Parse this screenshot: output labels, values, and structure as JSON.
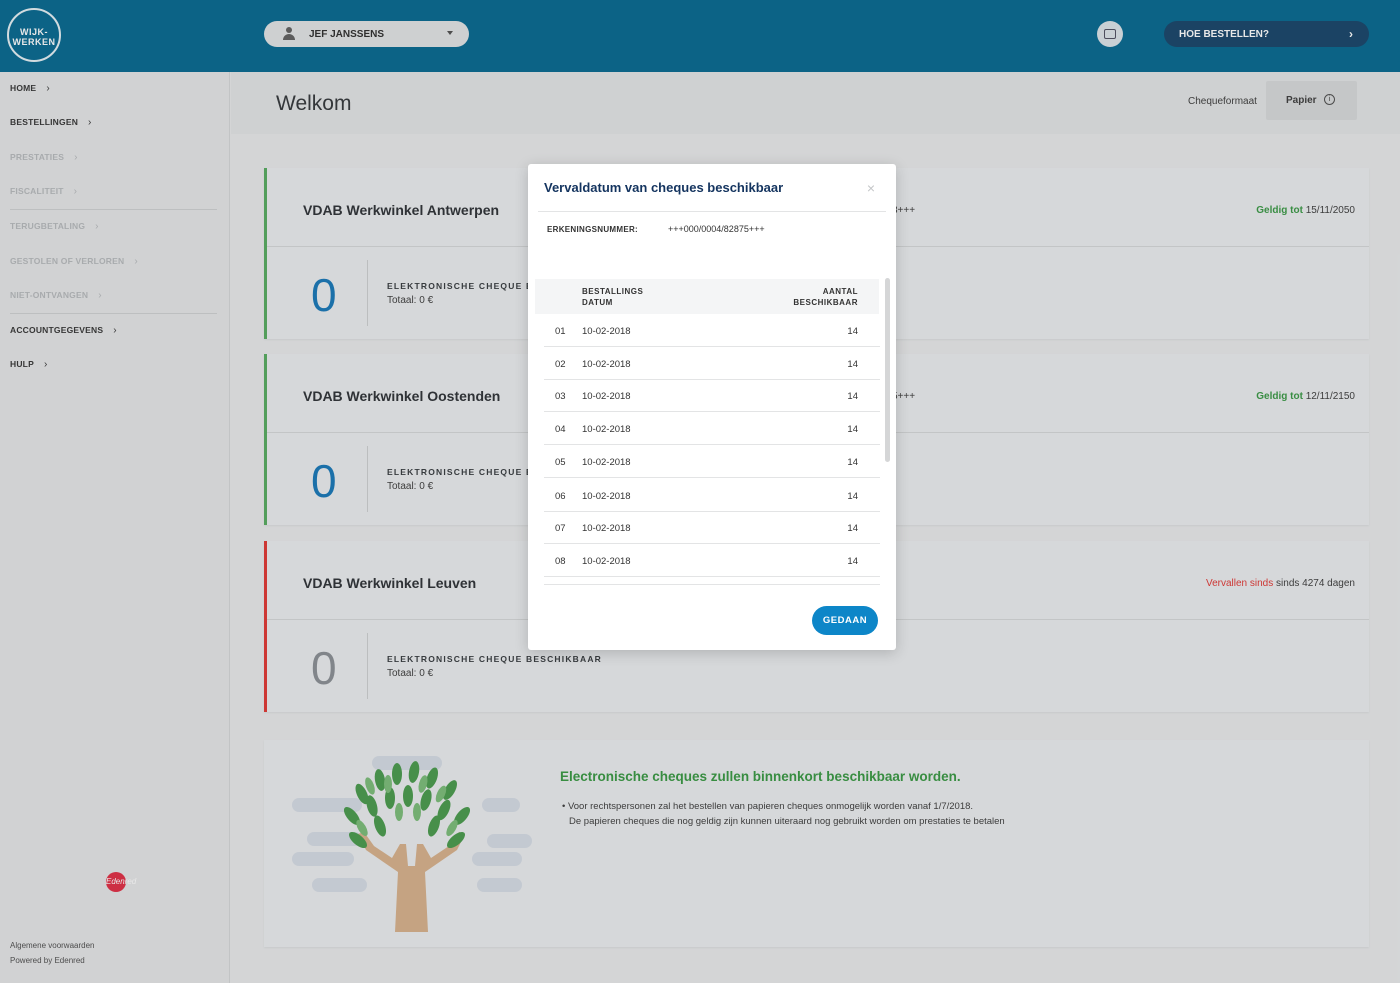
{
  "header": {
    "logo_line1": "WIJK-",
    "logo_line2": "WERKEN",
    "user_name": "JEF JANSSENS",
    "how_to_order": "HOE BESTELLEN?"
  },
  "sidebar": {
    "items": [
      {
        "label": "HOME",
        "enabled": true
      },
      {
        "label": "BESTELLINGEN",
        "enabled": true
      },
      {
        "label": "PRESTATIES",
        "enabled": false
      },
      {
        "label": "FISCALITEIT",
        "enabled": false
      },
      {
        "label": "TERUGBETALING",
        "enabled": false
      },
      {
        "label": "GESTOLEN OF VERLOREN",
        "enabled": false
      },
      {
        "label": "NIET-ONTVANGEN",
        "enabled": false
      },
      {
        "label": "ACCOUNTGEGEVENS",
        "enabled": true
      },
      {
        "label": "HULP",
        "enabled": true
      }
    ],
    "footer_terms": "Algemene voorwaarden",
    "footer_powered": "Powered by Edenred",
    "edenred_logo_text": "Edenred"
  },
  "page": {
    "title": "Welkom",
    "cheque_format_label": "Chequeformaat",
    "cheque_format_value": "Papier"
  },
  "cards": [
    {
      "name": "VDAB Werkwinkel Antwerpen",
      "number_fragment": "3+++",
      "valid_prefix": "Geldig tot",
      "valid_value": "15/11/2050",
      "count": "0",
      "label": "ELEKTRONISCHE CHEQUE B",
      "total": "Totaal: 0 €",
      "status": "green"
    },
    {
      "name": "VDAB Werkwinkel Oostenden",
      "number_fragment": "5+++",
      "valid_prefix": "Geldig tot",
      "valid_value": "12/11/2150",
      "count": "0",
      "label": "ELEKTRONISCHE CHEQUE B",
      "total": "Totaal: 0 €",
      "status": "green"
    },
    {
      "name": "VDAB Werkwinkel Leuven",
      "number_fragment": "",
      "valid_prefix": "Vervallen sinds",
      "valid_value": "sinds 4274 dagen",
      "count": "0",
      "label": "ELEKTRONISCHE CHEQUE BESCHIKBAAR",
      "total": "Totaal: 0 €",
      "status": "red"
    }
  ],
  "info": {
    "title": "Electronische cheques zullen binnenkort beschikbaar worden.",
    "line1": "• Voor rechtspersonen zal het bestellen van papieren cheques onmogelijk worden vanaf 1/7/2018.",
    "line2": "De papieren cheques die nog geldig zijn kunnen uiteraard nog gebruikt worden om prestaties te betalen"
  },
  "modal": {
    "title": "Vervaldatum van cheques beschikbaar",
    "close": "×",
    "erkenning_label": "ERKENINGSNUMMER:",
    "erkenning_value": "+++000/0004/82875+++",
    "col_date_line1": "BESTALLINGS",
    "col_date_line2": "DATUM",
    "col_count_line1": "AANTAL",
    "col_count_line2": "BESCHIKBAAR",
    "rows": [
      {
        "n": "01",
        "date": "10-02-2018",
        "count": "14"
      },
      {
        "n": "02",
        "date": "10-02-2018",
        "count": "14"
      },
      {
        "n": "03",
        "date": "10-02-2018",
        "count": "14"
      },
      {
        "n": "04",
        "date": "10-02-2018",
        "count": "14"
      },
      {
        "n": "05",
        "date": "10-02-2018",
        "count": "14"
      },
      {
        "n": "06",
        "date": "10-02-2018",
        "count": "14"
      },
      {
        "n": "07",
        "date": "10-02-2018",
        "count": "14"
      },
      {
        "n": "08",
        "date": "10-02-2018",
        "count": "14"
      }
    ],
    "done_label": "GEDAAN"
  },
  "colors": {
    "topbar": "#0e6d94",
    "accent_blue": "#0d86c8",
    "valid_green": "#3f9c4a",
    "expired_red": "#e23d3a",
    "modal_title": "#14345f"
  }
}
